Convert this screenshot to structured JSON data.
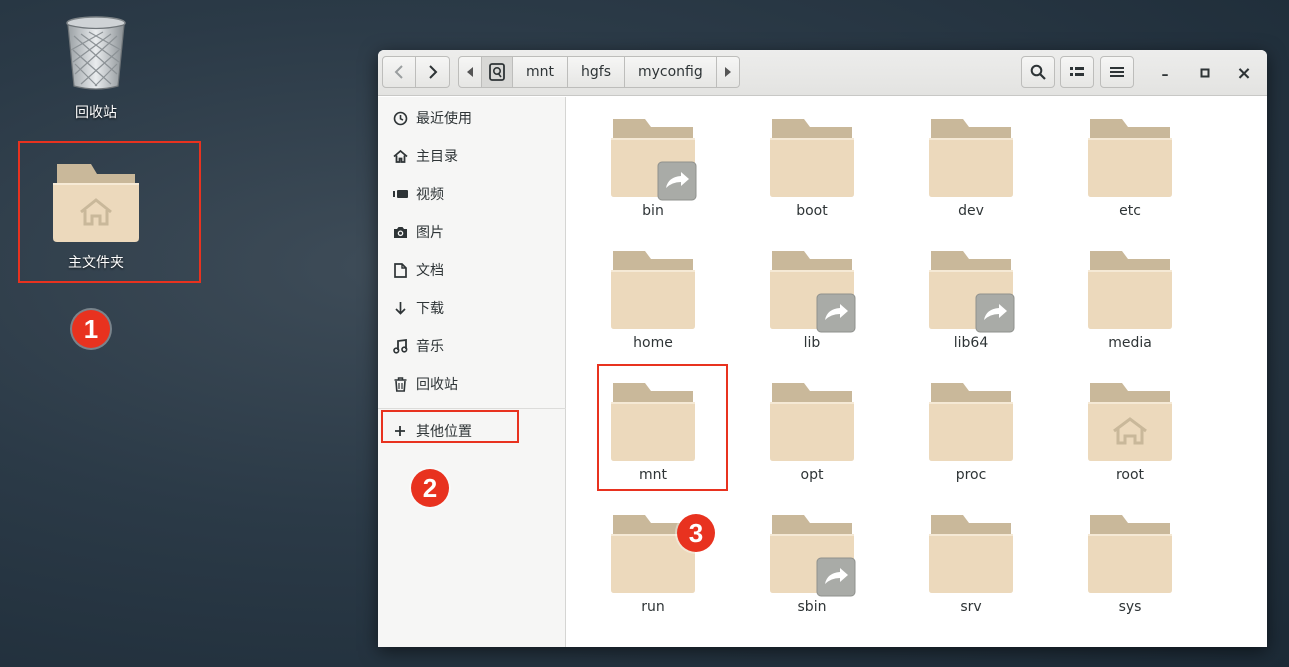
{
  "desktop": {
    "trash_label": "回收站",
    "home_label": "主文件夹"
  },
  "annotations": [
    "1",
    "2",
    "3"
  ],
  "colors": {
    "annotation": "#e8321f",
    "folder_body": "#ecd9bc",
    "folder_tab": "#c9b89a"
  },
  "toolbar": {
    "back_icon": "chevron-left-icon",
    "forward_icon": "chevron-right-icon",
    "path_left_icon": "triangle-left-icon",
    "path_right_icon": "triangle-right-icon",
    "path": [
      "mnt",
      "hgfs",
      "myconfig"
    ],
    "search_icon": "search-icon",
    "view_icon": "list-view-icon",
    "menu_icon": "hamburger-icon",
    "minimize": "–",
    "maximize": "▫",
    "close": "×"
  },
  "sidebar": {
    "items": [
      {
        "label": "最近使用",
        "icon": "clock-icon"
      },
      {
        "label": "主目录",
        "icon": "home-icon"
      },
      {
        "label": "视频",
        "icon": "video-icon"
      },
      {
        "label": "图片",
        "icon": "camera-icon"
      },
      {
        "label": "文档",
        "icon": "document-icon"
      },
      {
        "label": "下载",
        "icon": "download-icon"
      },
      {
        "label": "音乐",
        "icon": "music-icon"
      },
      {
        "label": "回收站",
        "icon": "trash-icon"
      }
    ],
    "other": {
      "label": "其他位置",
      "icon": "plus-icon"
    }
  },
  "files": [
    {
      "name": "bin",
      "link": true
    },
    {
      "name": "boot",
      "link": false
    },
    {
      "name": "dev",
      "link": false
    },
    {
      "name": "etc",
      "link": false
    },
    {
      "name": "home",
      "link": false
    },
    {
      "name": "lib",
      "link": true
    },
    {
      "name": "lib64",
      "link": true
    },
    {
      "name": "media",
      "link": false
    },
    {
      "name": "mnt",
      "link": false
    },
    {
      "name": "opt",
      "link": false
    },
    {
      "name": "proc",
      "link": false
    },
    {
      "name": "root",
      "link": false,
      "home": true
    },
    {
      "name": "run",
      "link": false
    },
    {
      "name": "sbin",
      "link": true
    },
    {
      "name": "srv",
      "link": false
    },
    {
      "name": "sys",
      "link": false
    }
  ]
}
